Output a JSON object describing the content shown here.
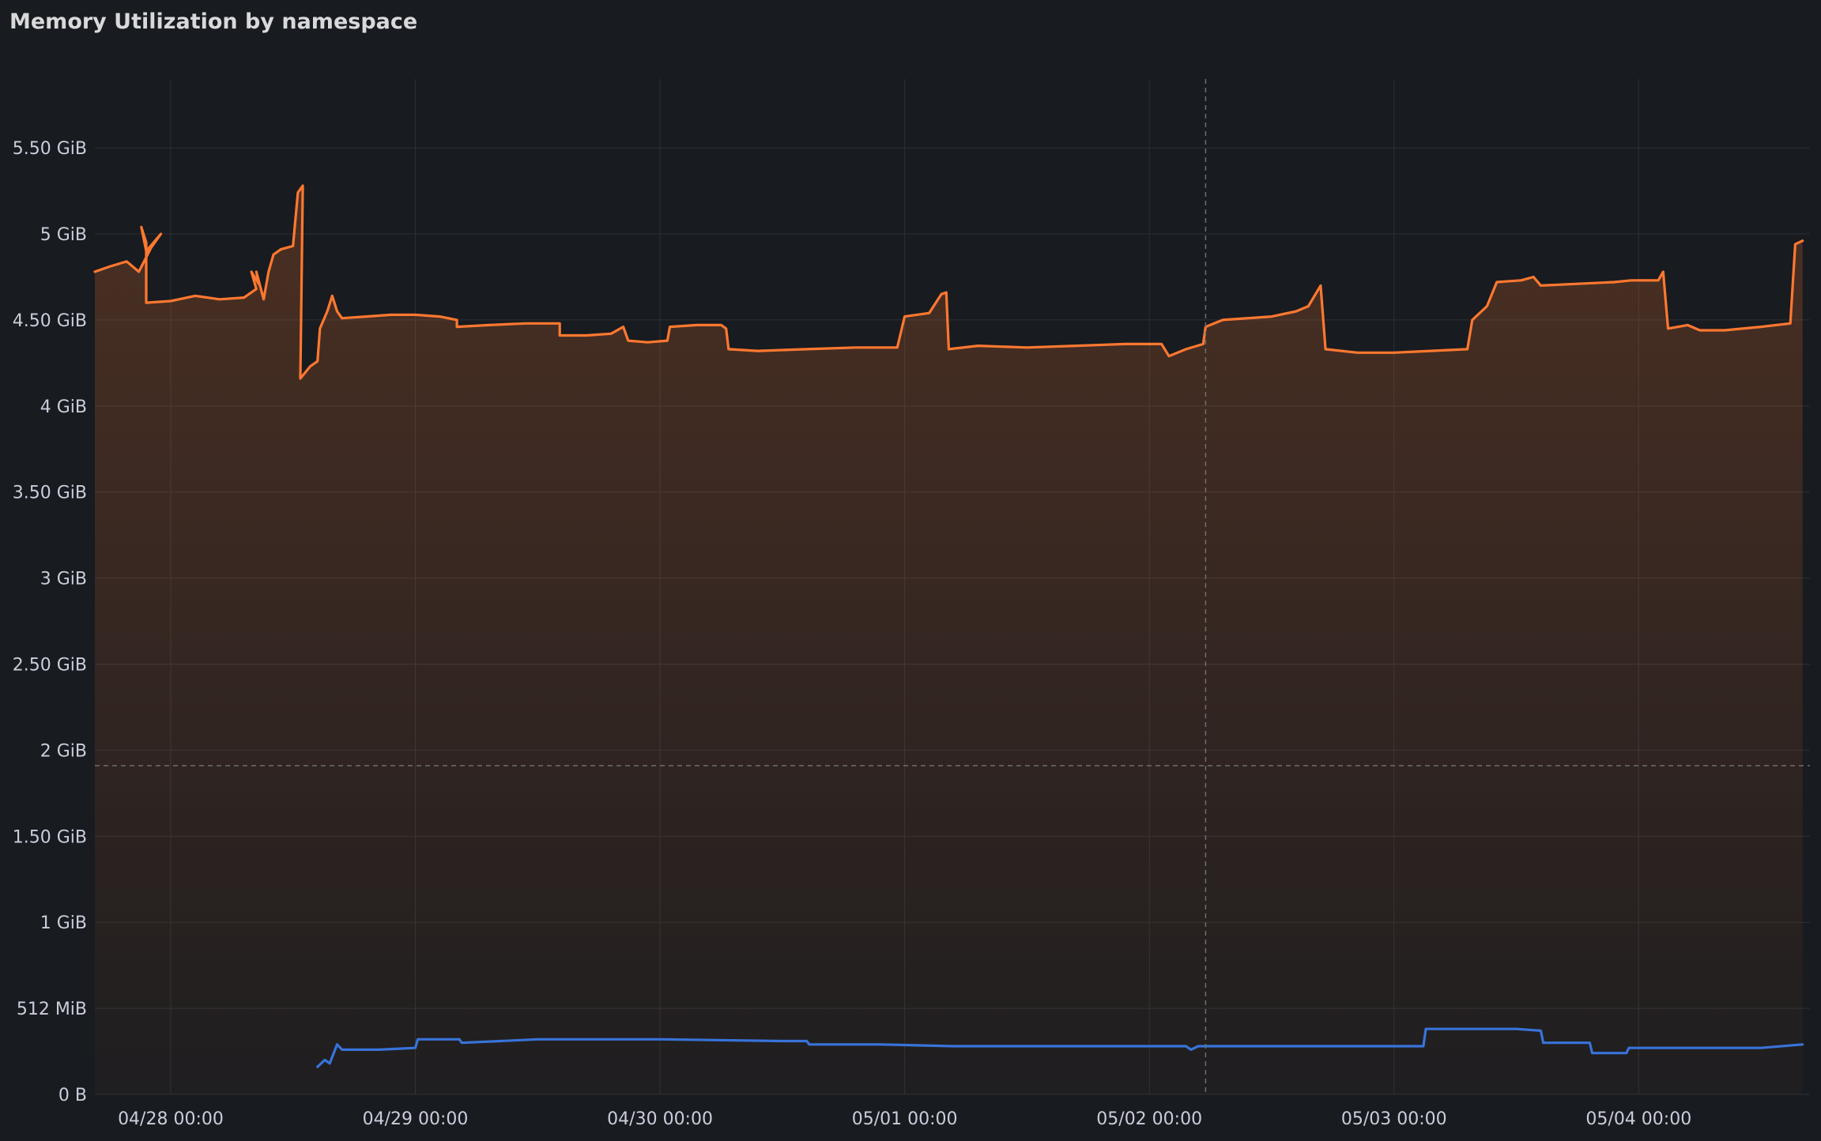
{
  "panel": {
    "title": "Memory Utilization by namespace"
  },
  "colors": {
    "background": "#181b1f",
    "grid": "#2c2f34",
    "text": "#ccccdc",
    "series_orange": "#ff7830",
    "series_blue": "#3873d9",
    "crosshair": "#6e6e6e"
  },
  "chart_data": {
    "type": "line",
    "title": "Memory Utilization by namespace",
    "xlabel": "",
    "ylabel": "",
    "y_unit": "GiB",
    "ylim": [
      0,
      5.9
    ],
    "y_ticks": [
      {
        "value": 0,
        "label": "0 B"
      },
      {
        "value": 0.5,
        "label": "512 MiB"
      },
      {
        "value": 1,
        "label": "1 GiB"
      },
      {
        "value": 1.5,
        "label": "1.50 GiB"
      },
      {
        "value": 2,
        "label": "2 GiB"
      },
      {
        "value": 2.5,
        "label": "2.50 GiB"
      },
      {
        "value": 3,
        "label": "3 GiB"
      },
      {
        "value": 3.5,
        "label": "3.50 GiB"
      },
      {
        "value": 4,
        "label": "4 GiB"
      },
      {
        "value": 4.5,
        "label": "4.50 GiB"
      },
      {
        "value": 5,
        "label": "5 GiB"
      },
      {
        "value": 5.5,
        "label": "5.50 GiB"
      }
    ],
    "x_unit": "days since 04/28 00:00",
    "xlim": [
      -0.31,
      6.7
    ],
    "x_ticks": [
      {
        "value": 0,
        "label": "04/28 00:00"
      },
      {
        "value": 1,
        "label": "04/29 00:00"
      },
      {
        "value": 2,
        "label": "04/30 00:00"
      },
      {
        "value": 3,
        "label": "05/01 00:00"
      },
      {
        "value": 4,
        "label": "05/02 00:00"
      },
      {
        "value": 5,
        "label": "05/03 00:00"
      },
      {
        "value": 6,
        "label": "05/04 00:00"
      }
    ],
    "grid": true,
    "legend": "none",
    "crosshair": {
      "x": 4.23,
      "y": 1.91
    },
    "series": [
      {
        "name": "",
        "color": "#ff7830",
        "fill": true,
        "points": [
          [
            -0.31,
            4.78
          ],
          [
            -0.25,
            4.81
          ],
          [
            -0.18,
            4.84
          ],
          [
            -0.13,
            4.78
          ],
          [
            -0.08,
            4.92
          ],
          [
            -0.04,
            5.0
          ],
          [
            -0.1,
            4.9
          ],
          [
            -0.12,
            5.04
          ],
          [
            -0.1,
            4.95
          ],
          [
            -0.1,
            4.6
          ],
          [
            0.0,
            4.61
          ],
          [
            0.1,
            4.64
          ],
          [
            0.2,
            4.62
          ],
          [
            0.3,
            4.63
          ],
          [
            0.35,
            4.68
          ],
          [
            0.33,
            4.78
          ],
          [
            0.36,
            4.71
          ],
          [
            0.35,
            4.78
          ],
          [
            0.38,
            4.62
          ],
          [
            0.4,
            4.78
          ],
          [
            0.42,
            4.88
          ],
          [
            0.45,
            4.91
          ],
          [
            0.5,
            4.93
          ],
          [
            0.52,
            5.24
          ],
          [
            0.54,
            5.28
          ],
          [
            0.53,
            4.16
          ],
          [
            0.57,
            4.23
          ],
          [
            0.6,
            4.26
          ],
          [
            0.61,
            4.45
          ],
          [
            0.64,
            4.55
          ],
          [
            0.66,
            4.64
          ],
          [
            0.68,
            4.55
          ],
          [
            0.7,
            4.51
          ],
          [
            0.8,
            4.52
          ],
          [
            0.9,
            4.53
          ],
          [
            1.0,
            4.53
          ],
          [
            1.1,
            4.52
          ],
          [
            1.17,
            4.5
          ],
          [
            1.17,
            4.46
          ],
          [
            1.3,
            4.47
          ],
          [
            1.45,
            4.48
          ],
          [
            1.5,
            4.48
          ],
          [
            1.59,
            4.48
          ],
          [
            1.59,
            4.41
          ],
          [
            1.7,
            4.41
          ],
          [
            1.8,
            4.42
          ],
          [
            1.85,
            4.46
          ],
          [
            1.87,
            4.38
          ],
          [
            1.95,
            4.37
          ],
          [
            2.03,
            4.38
          ],
          [
            2.04,
            4.46
          ],
          [
            2.15,
            4.47
          ],
          [
            2.25,
            4.47
          ],
          [
            2.27,
            4.45
          ],
          [
            2.28,
            4.33
          ],
          [
            2.4,
            4.32
          ],
          [
            2.6,
            4.33
          ],
          [
            2.8,
            4.34
          ],
          [
            2.97,
            4.34
          ],
          [
            3.0,
            4.52
          ],
          [
            3.1,
            4.54
          ],
          [
            3.15,
            4.65
          ],
          [
            3.17,
            4.66
          ],
          [
            3.18,
            4.33
          ],
          [
            3.3,
            4.35
          ],
          [
            3.5,
            4.34
          ],
          [
            3.7,
            4.35
          ],
          [
            3.9,
            4.36
          ],
          [
            4.05,
            4.36
          ],
          [
            4.08,
            4.29
          ],
          [
            4.15,
            4.33
          ],
          [
            4.22,
            4.36
          ],
          [
            4.23,
            4.46
          ],
          [
            4.3,
            4.5
          ],
          [
            4.5,
            4.52
          ],
          [
            4.6,
            4.55
          ],
          [
            4.65,
            4.58
          ],
          [
            4.7,
            4.7
          ],
          [
            4.72,
            4.33
          ],
          [
            4.85,
            4.31
          ],
          [
            5.0,
            4.31
          ],
          [
            5.15,
            4.32
          ],
          [
            5.3,
            4.33
          ],
          [
            5.32,
            4.5
          ],
          [
            5.38,
            4.58
          ],
          [
            5.42,
            4.72
          ],
          [
            5.52,
            4.73
          ],
          [
            5.57,
            4.75
          ],
          [
            5.6,
            4.7
          ],
          [
            5.75,
            4.71
          ],
          [
            5.9,
            4.72
          ],
          [
            5.97,
            4.73
          ],
          [
            6.08,
            4.73
          ],
          [
            6.1,
            4.78
          ],
          [
            6.12,
            4.45
          ],
          [
            6.2,
            4.47
          ],
          [
            6.25,
            4.44
          ],
          [
            6.35,
            4.44
          ],
          [
            6.5,
            4.46
          ],
          [
            6.62,
            4.48
          ],
          [
            6.64,
            4.94
          ],
          [
            6.67,
            4.96
          ]
        ]
      },
      {
        "name": "",
        "color": "#3873d9",
        "fill": false,
        "points": [
          [
            0.6,
            0.16
          ],
          [
            0.63,
            0.2
          ],
          [
            0.65,
            0.18
          ],
          [
            0.68,
            0.29
          ],
          [
            0.7,
            0.26
          ],
          [
            0.85,
            0.26
          ],
          [
            1.0,
            0.27
          ],
          [
            1.01,
            0.32
          ],
          [
            1.1,
            0.32
          ],
          [
            1.18,
            0.32
          ],
          [
            1.19,
            0.3
          ],
          [
            1.35,
            0.31
          ],
          [
            1.5,
            0.32
          ],
          [
            2.0,
            0.32
          ],
          [
            2.5,
            0.31
          ],
          [
            2.6,
            0.31
          ],
          [
            2.61,
            0.29
          ],
          [
            2.9,
            0.29
          ],
          [
            3.2,
            0.28
          ],
          [
            3.5,
            0.28
          ],
          [
            3.8,
            0.28
          ],
          [
            4.15,
            0.28
          ],
          [
            4.17,
            0.26
          ],
          [
            4.2,
            0.28
          ],
          [
            4.6,
            0.28
          ],
          [
            5.12,
            0.28
          ],
          [
            5.13,
            0.38
          ],
          [
            5.5,
            0.38
          ],
          [
            5.6,
            0.37
          ],
          [
            5.61,
            0.3
          ],
          [
            5.8,
            0.3
          ],
          [
            5.81,
            0.24
          ],
          [
            5.95,
            0.24
          ],
          [
            5.96,
            0.27
          ],
          [
            6.2,
            0.27
          ],
          [
            6.5,
            0.27
          ],
          [
            6.67,
            0.29
          ]
        ]
      }
    ]
  }
}
